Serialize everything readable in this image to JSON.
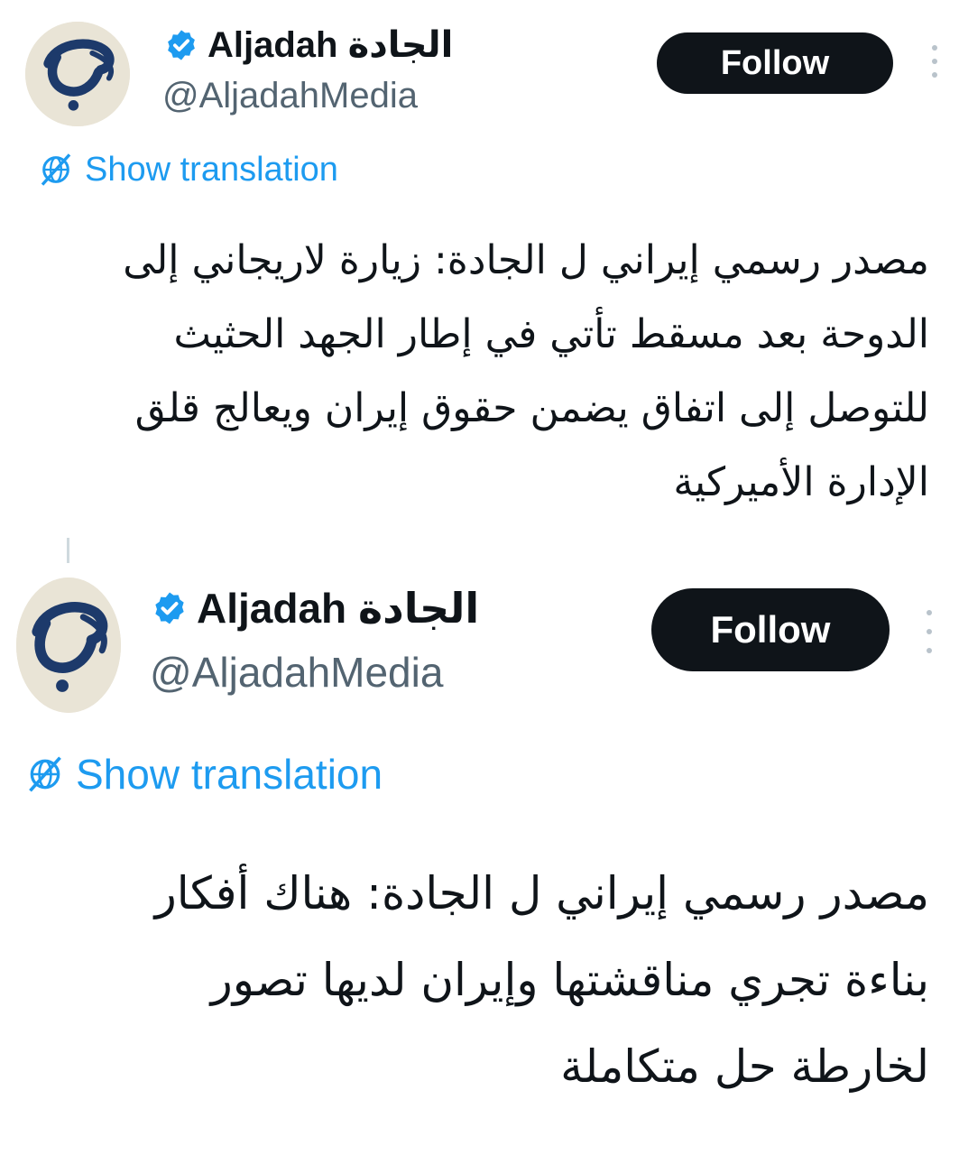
{
  "tweets": [
    {
      "display_name": "Aljadah الجادة",
      "handle": "@AljadahMedia",
      "follow_label": "Follow",
      "translate_label": "Show translation",
      "text": "مصدر رسمي إيراني ل الجادة: زيارة لاريجاني إلى الدوحة بعد مسقط تأتي في إطار الجهد الحثيث للتوصل إلى اتفاق يضمن حقوق إيران ويعالج قلق الإدارة الأميركية"
    },
    {
      "display_name": "Aljadah الجادة",
      "handle": "@AljadahMedia",
      "follow_label": "Follow",
      "translate_label": "Show translation",
      "text": "مصدر رسمي إيراني ل الجادة: هناك أفكار بناءة تجري مناقشتها وإيران لديها تصور لخارطة حل متكاملة"
    }
  ],
  "colors": {
    "accent": "#1d9bf0",
    "follow_bg": "#0f1419",
    "handle": "#536471",
    "text": "#0f1419",
    "avatar_bg": "#e9e4d6",
    "logo": "#1d3a6b"
  },
  "icons": {
    "verified": "verified-badge-icon",
    "translate": "globe-slash-icon",
    "more": "more-vertical-icon"
  }
}
